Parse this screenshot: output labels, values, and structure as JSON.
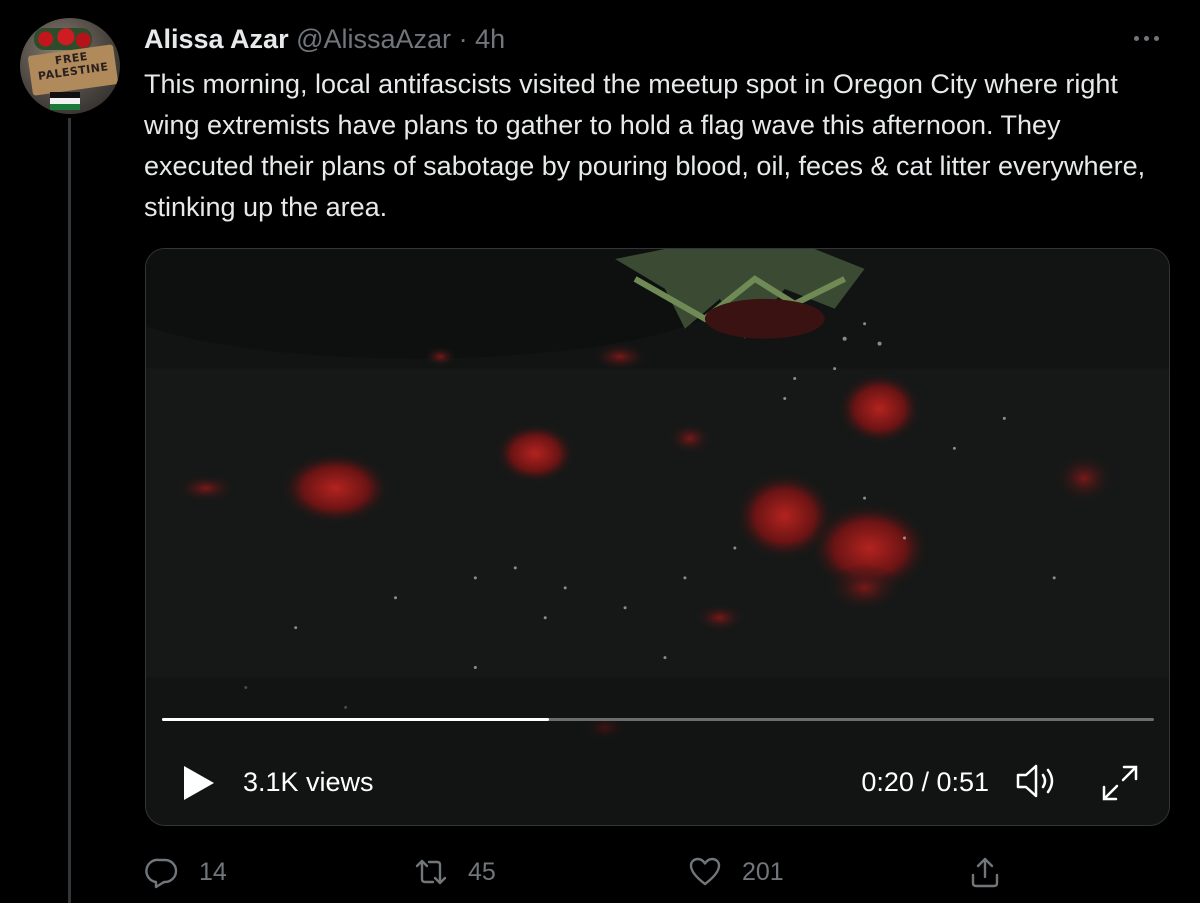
{
  "tweet": {
    "author_name": "Alissa Azar",
    "handle": "@AlissaAzar",
    "separator": "·",
    "time_ago": "4h",
    "avatar_sign_text": "FREE PALESTINE",
    "text": "This morning, local antifascists visited the meetup spot in Oregon City where right wing extremists have plans to gather to hold a flag wave this afternoon. They executed their plans of sabotage by pouring blood, oil, feces & cat litter everywhere, stinking up the area."
  },
  "video": {
    "views": "3.1K views",
    "time": "0:20 / 0:51",
    "progress_fraction": 0.39
  },
  "actions": {
    "reply_count": "14",
    "retweet_count": "45",
    "like_count": "201"
  },
  "colors": {
    "background": "#000000",
    "text": "#e7e9ea",
    "muted": "#71767b",
    "border": "#333639"
  },
  "icons": {
    "more": "more-horizontal-icon",
    "play": "play-icon",
    "volume": "volume-icon",
    "fullscreen": "fullscreen-icon",
    "reply": "reply-icon",
    "retweet": "retweet-icon",
    "like": "heart-icon",
    "share": "share-icon"
  }
}
